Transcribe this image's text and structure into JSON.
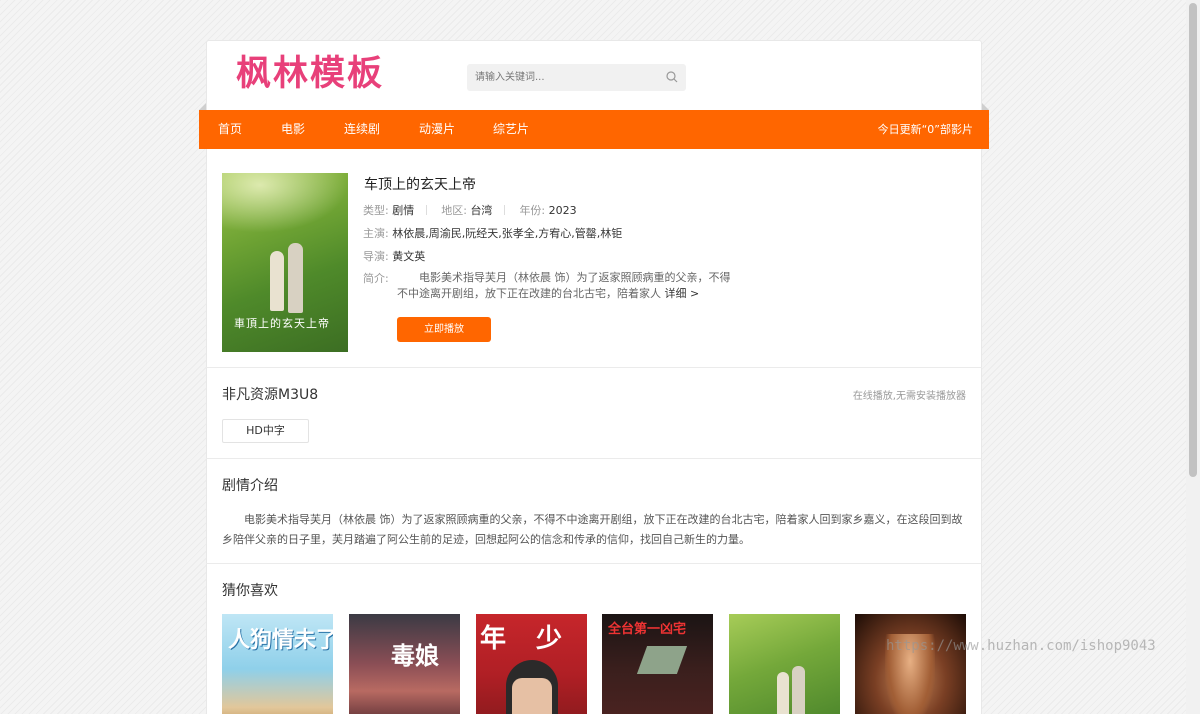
{
  "site": {
    "logo_text": "枫林模板",
    "search_placeholder": "请输入关键词..."
  },
  "nav": {
    "items": [
      "首页",
      "电影",
      "连续剧",
      "动漫片",
      "综艺片"
    ],
    "today_update": "今日更新“0”部影片"
  },
  "movie": {
    "title": "车顶上的玄天上帝",
    "poster_caption": "車頂上的玄天上帝",
    "type_label": "类型:",
    "type_value": "剧情",
    "region_label": "地区:",
    "region_value": "台湾",
    "year_label": "年份:",
    "year_value": "2023",
    "cast_label": "主演:",
    "cast_value": "林依晨,周渝民,阮经天,张孝全,方宥心,管罄,林钜",
    "director_label": "导演:",
    "director_value": "黄文英",
    "intro_label": "简介:",
    "intro_text": "电影美术指导芙月（林依晨 饰）为了返家照顾病重的父亲，不得不中途离开剧组，放下正在改建的台北古宅，陪着家人",
    "more_label": "详细 >",
    "play_button": "立即播放"
  },
  "source": {
    "title": "非凡资源M3U8",
    "note": "在线播放,无需安装播放器",
    "episodes": [
      "HD中字"
    ]
  },
  "plot": {
    "title": "剧情介绍",
    "text": "电影美术指导芙月（林依晨 饰）为了返家照顾病重的父亲，不得不中途离开剧组，放下正在改建的台北古宅，陪着家人回到家乡嘉义，在这段回到故乡陪伴父亲的日子里，芙月踏遍了阿公生前的足迹，回想起阿公的信念和传承的信仰，找回自己新生的力量。"
  },
  "recommend": {
    "title": "猜你喜欢",
    "items": [
      {
        "caption": "人狗情未了"
      },
      {
        "caption": "毒娘"
      },
      {
        "caption": "年少"
      },
      {
        "caption": "全台第一凶宅"
      },
      {
        "caption": ""
      },
      {
        "caption": ""
      }
    ]
  },
  "watermark": "https://www.huzhan.com/ishop9043",
  "colors": {
    "accent": "#ff6600",
    "logo": "#e8407a"
  }
}
